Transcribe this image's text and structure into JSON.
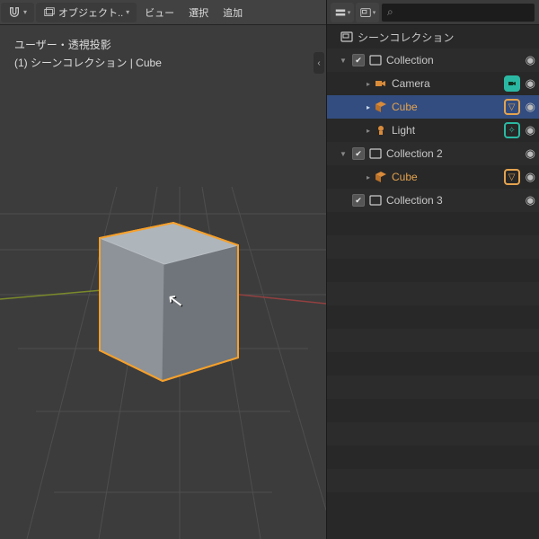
{
  "viewport": {
    "header": {
      "mode_label": "オブジェクト..",
      "view": "ビュー",
      "select": "選択",
      "add": "追加"
    },
    "overlay_line1": "ユーザー・透視投影",
    "overlay_line2": "(1) シーンコレクション | Cube"
  },
  "outliner": {
    "search_placeholder": "",
    "root_label": "シーンコレクション",
    "rows": [
      {
        "label": "Collection",
        "type": "collection",
        "expanded": true,
        "checked": true,
        "has_eye": true
      },
      {
        "label": "Camera",
        "type": "camera",
        "has_eye": true,
        "badge": "green-solid"
      },
      {
        "label": "Cube",
        "type": "mesh",
        "has_eye": true,
        "badge": "orange",
        "active": true,
        "text_orange": true
      },
      {
        "label": "Light",
        "type": "light",
        "has_eye": true,
        "badge": "teal"
      },
      {
        "label": "Collection 2",
        "type": "collection",
        "expanded": true,
        "checked": true,
        "has_eye": true
      },
      {
        "label": "Cube",
        "type": "mesh",
        "has_eye": true,
        "badge": "orange",
        "text_orange": true
      },
      {
        "label": "Collection 3",
        "type": "collection",
        "expanded": false,
        "checked": true,
        "has_eye": true
      }
    ]
  },
  "colors": {
    "selection_outline": "#f6a02b",
    "cube_light": "#aeb5bb",
    "cube_mid": "#8d9398",
    "cube_dark": "#6f757a"
  }
}
